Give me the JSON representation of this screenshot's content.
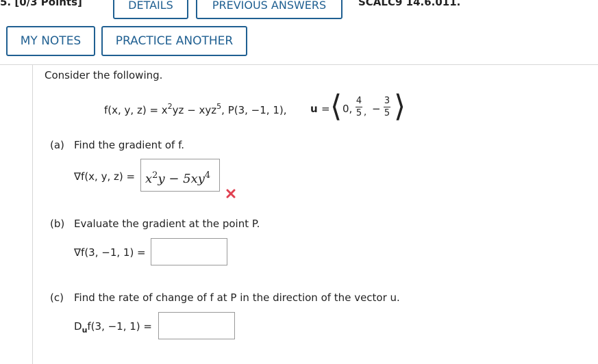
{
  "header": {
    "question_number": "5. [0/3 Points]",
    "tab_details": "DETAILS",
    "tab_previous_answers": "PREVIOUS ANSWERS",
    "problem_code": "SCALC9 14.6.011."
  },
  "toolbar": {
    "my_notes": "MY NOTES",
    "practice_another": "PRACTICE ANOTHER"
  },
  "problem": {
    "intro": "Consider the following.",
    "function_lhs": "f(x, y, z) = x",
    "function_rhs_a": "yz − xyz",
    "exp_2": "2",
    "exp_5": "5",
    "point": ", P(3, −1, 1),",
    "u_label": "u",
    "u_equals": "=",
    "u_zero": "0,",
    "u_num1": "4",
    "u_den1": "5",
    "u_num2": "3",
    "u_den2": "5",
    "u_minus": "−"
  },
  "part_a": {
    "label": "(a)",
    "text": "Find the gradient of f.",
    "lhs": "∇f(x, y, z) =",
    "answer_base": "x",
    "answer_exp1": "2",
    "answer_mid": "y − 5xy",
    "answer_exp2": "4",
    "status": "incorrect",
    "status_color": "#e04050"
  },
  "part_b": {
    "label": "(b)",
    "text": "Evaluate the gradient at the point P.",
    "lhs": "∇f(3, −1, 1) =",
    "answer": ""
  },
  "part_c": {
    "label": "(c)",
    "text": "Find the rate of change of f at P in the direction of the vector u.",
    "lhs_d": "D",
    "lhs_sub": "u",
    "lhs_rest": "f(3, −1, 1) =",
    "answer": ""
  },
  "colors": {
    "accent": "#1f5f91",
    "error": "#e04050"
  }
}
